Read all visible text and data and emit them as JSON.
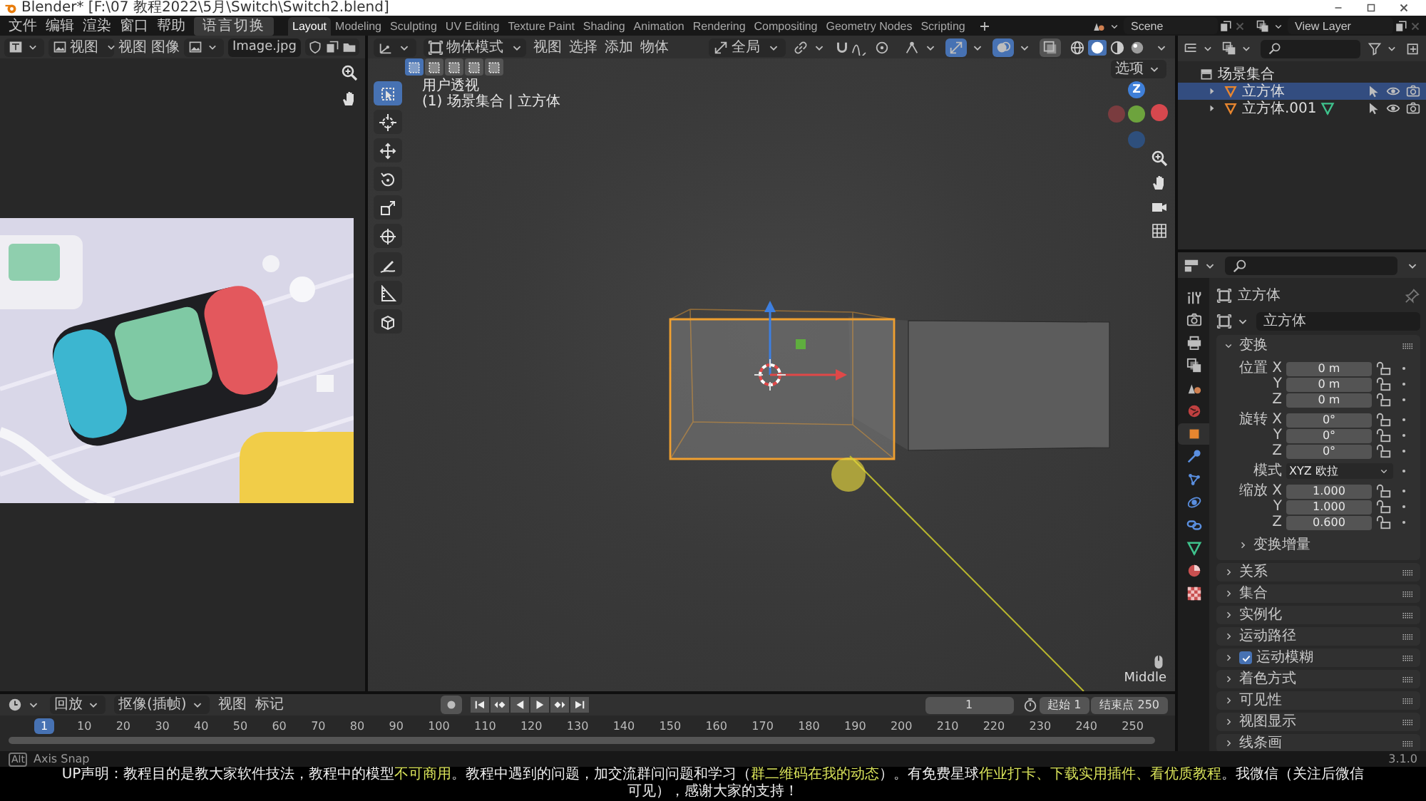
{
  "window": {
    "title": "Blender* [F:\\07 教程2022\\5月\\Switch\\Switch2.blend]"
  },
  "menu": [
    "文件",
    "编辑",
    "渲染",
    "窗口",
    "帮助"
  ],
  "language_button": "语言切换",
  "workspaces": [
    {
      "label": "Layout",
      "selected": true
    },
    {
      "label": "Modeling",
      "selected": false
    },
    {
      "label": "Sculpting",
      "selected": false
    },
    {
      "label": "UV Editing",
      "selected": false
    },
    {
      "label": "Texture Paint",
      "selected": false
    },
    {
      "label": "Shading",
      "selected": false
    },
    {
      "label": "Animation",
      "selected": false
    },
    {
      "label": "Rendering",
      "selected": false
    },
    {
      "label": "Compositing",
      "selected": false
    },
    {
      "label": "Geometry Nodes",
      "selected": false
    },
    {
      "label": "Scripting",
      "selected": false
    }
  ],
  "scene": "Scene",
  "view_layer": "View Layer",
  "image_editor": {
    "view_mode": "视图",
    "menus": [
      "视图",
      "图像"
    ],
    "image_name": "Image.jpg",
    "image": {
      "kind": "picture"
    }
  },
  "viewport": {
    "mode": "物体模式",
    "menus": [
      "视图",
      "选择",
      "添加",
      "物体"
    ],
    "orientation": "全局",
    "shading": [
      {
        "kind": "wireframe",
        "selected": false
      },
      {
        "kind": "solid",
        "selected": true
      },
      {
        "kind": "material",
        "selected": false
      },
      {
        "kind": "rendered",
        "selected": false
      }
    ],
    "select_modes": [
      {
        "selected": true
      },
      {
        "selected": false
      },
      {
        "selected": false
      },
      {
        "selected": false
      },
      {
        "selected": false
      }
    ],
    "options": "选项",
    "view_name": "用户透视",
    "collection_info": "(1) 场景集合 | 立方体",
    "tools": [
      {
        "kind": "select",
        "selected": true
      },
      {
        "kind": "cursor",
        "selected": false
      },
      {
        "kind": "move",
        "selected": false
      },
      {
        "kind": "rotate",
        "selected": false
      },
      {
        "kind": "scale",
        "selected": false
      },
      {
        "kind": "transform",
        "selected": false
      },
      {
        "kind": "annotate",
        "selected": false
      },
      {
        "kind": "measure",
        "selected": false
      },
      {
        "kind": "addcube",
        "selected": false
      }
    ],
    "nav_axis": "Z",
    "mouse_hint": "Middle"
  },
  "outliner": {
    "root": "场景集合",
    "items": [
      {
        "name": "立方体",
        "selected": true,
        "expanded": false
      },
      {
        "name": "立方体.001",
        "selected": false,
        "expanded": false
      }
    ]
  },
  "properties": {
    "tabs": [
      {
        "kind": "tool",
        "selected": false
      },
      {
        "kind": "render",
        "selected": false
      },
      {
        "kind": "output",
        "selected": false
      },
      {
        "kind": "viewlayer",
        "selected": false
      },
      {
        "kind": "scene",
        "selected": false
      },
      {
        "kind": "world",
        "selected": false
      },
      {
        "kind": "object",
        "selected": true
      },
      {
        "kind": "modifier",
        "selected": false
      },
      {
        "kind": "particles",
        "selected": false
      },
      {
        "kind": "physics",
        "selected": false
      },
      {
        "kind": "constraints",
        "selected": false
      },
      {
        "kind": "data",
        "selected": false
      },
      {
        "kind": "material",
        "selected": false
      },
      {
        "kind": "texture",
        "selected": false
      }
    ],
    "object_name": "立方体",
    "data_name": "立方体",
    "transform": {
      "title": "变换",
      "expanded": true,
      "groups": [
        {
          "rows": [
            {
              "kind": "number",
              "label": "位置 X",
              "value": "0 m"
            },
            {
              "kind": "number",
              "label": "Y",
              "value": "0 m"
            },
            {
              "kind": "number",
              "label": "Z",
              "value": "0 m"
            }
          ]
        },
        {
          "rows": [
            {
              "kind": "number",
              "label": "旋转 X",
              "value": "0°"
            },
            {
              "kind": "number",
              "label": "Y",
              "value": "0°"
            },
            {
              "kind": "number",
              "label": "Z",
              "value": "0°"
            }
          ]
        },
        {
          "rows": [
            {
              "kind": "dropdown",
              "label": "模式",
              "value": "XYZ 欧拉"
            }
          ]
        },
        {
          "rows": [
            {
              "kind": "number",
              "label": "缩放 X",
              "value": "1.000"
            },
            {
              "kind": "number",
              "label": "Y",
              "value": "1.000"
            },
            {
              "kind": "number",
              "label": "Z",
              "value": "0.600"
            }
          ]
        }
      ],
      "subpanel": {
        "title": "变换增量",
        "expanded": false
      }
    },
    "panels": [
      {
        "kind": "plain",
        "title": "关系",
        "expanded": false
      },
      {
        "kind": "plain",
        "title": "集合",
        "expanded": false
      },
      {
        "kind": "plain",
        "title": "实例化",
        "expanded": false
      },
      {
        "kind": "plain",
        "title": "运动路径",
        "expanded": false
      },
      {
        "kind": "checkbox",
        "title": "运动模糊",
        "expanded": false,
        "checked": true
      },
      {
        "kind": "plain",
        "title": "着色方式",
        "expanded": false
      },
      {
        "kind": "plain",
        "title": "可见性",
        "expanded": false
      },
      {
        "kind": "plain",
        "title": "视图显示",
        "expanded": false
      },
      {
        "kind": "plain",
        "title": "线条画",
        "expanded": false
      }
    ]
  },
  "timeline": {
    "dropdowns": [
      "回放",
      "抠像(插帧)"
    ],
    "menus": [
      "视图",
      "标记"
    ],
    "current_frame": "1",
    "start_label": "起始",
    "start": "1",
    "end_label": "结束点",
    "end": "250",
    "frame_marker": "1",
    "ruler": [
      "10",
      "20",
      "30",
      "40",
      "50",
      "60",
      "70",
      "80",
      "90",
      "100",
      "110",
      "120",
      "130",
      "140",
      "150",
      "160",
      "170",
      "180",
      "190",
      "200",
      "210",
      "220",
      "230",
      "240",
      "250"
    ]
  },
  "status_bar": {
    "key": "Alt",
    "hint": "Axis Snap",
    "version": "3.1.0"
  },
  "caption": "UP声明：教程目的是教大家软件技法，教程中的模型**不可商用**。教程中遇到的问题，加交流群问问题和学习（**群二维码在我的动态**）。有免费星球**作业打卡、下载实用插件、看优质教程**。我微信（关注后微信可见），感谢大家的支持！"
}
